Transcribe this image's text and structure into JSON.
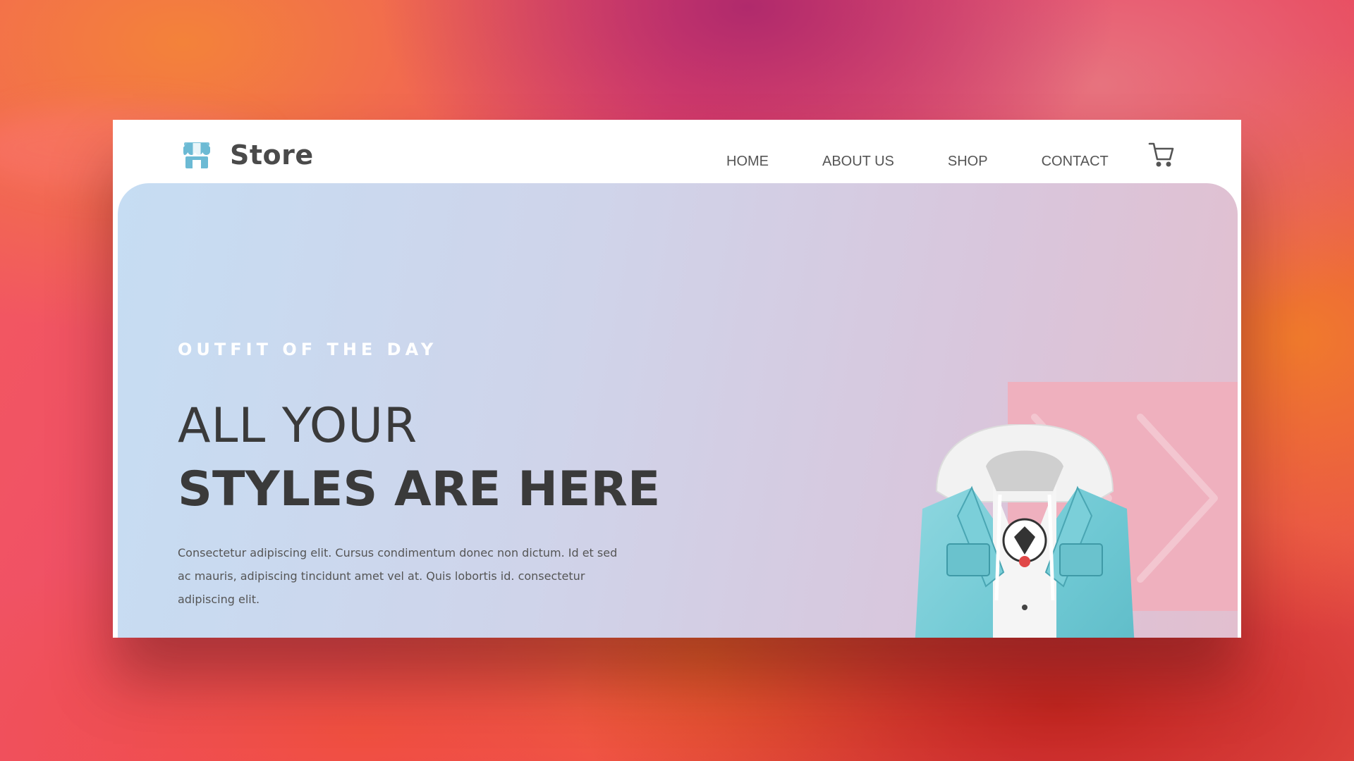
{
  "brand": {
    "name": "Store",
    "logo_icon": "storefront-icon",
    "accent_color": "#6cbad4"
  },
  "nav": {
    "links": [
      "HOME",
      "ABOUT US",
      "SHOP",
      "CONTACT"
    ],
    "cart_icon": "shopping-cart-icon"
  },
  "hero": {
    "tagline": "OUTFIT OF THE DAY",
    "headline_line1": "ALL YOUR",
    "headline_line2": "STYLES ARE HERE",
    "description": "Consectetur adipiscing elit. Cursus condimentum donec non dictum. Id et sed ac mauris, adipiscing tincidunt amet vel at. Quis lobortis id. consectetur adipiscing elit.",
    "image": "denim-jacket-image",
    "decor_icon": "chevron-right-icon",
    "colors": {
      "gradient_start": "#c6ddf3",
      "gradient_end": "#e2bfcf",
      "accent_block": "#efb0be",
      "headline_text": "#3a3a3a"
    }
  }
}
